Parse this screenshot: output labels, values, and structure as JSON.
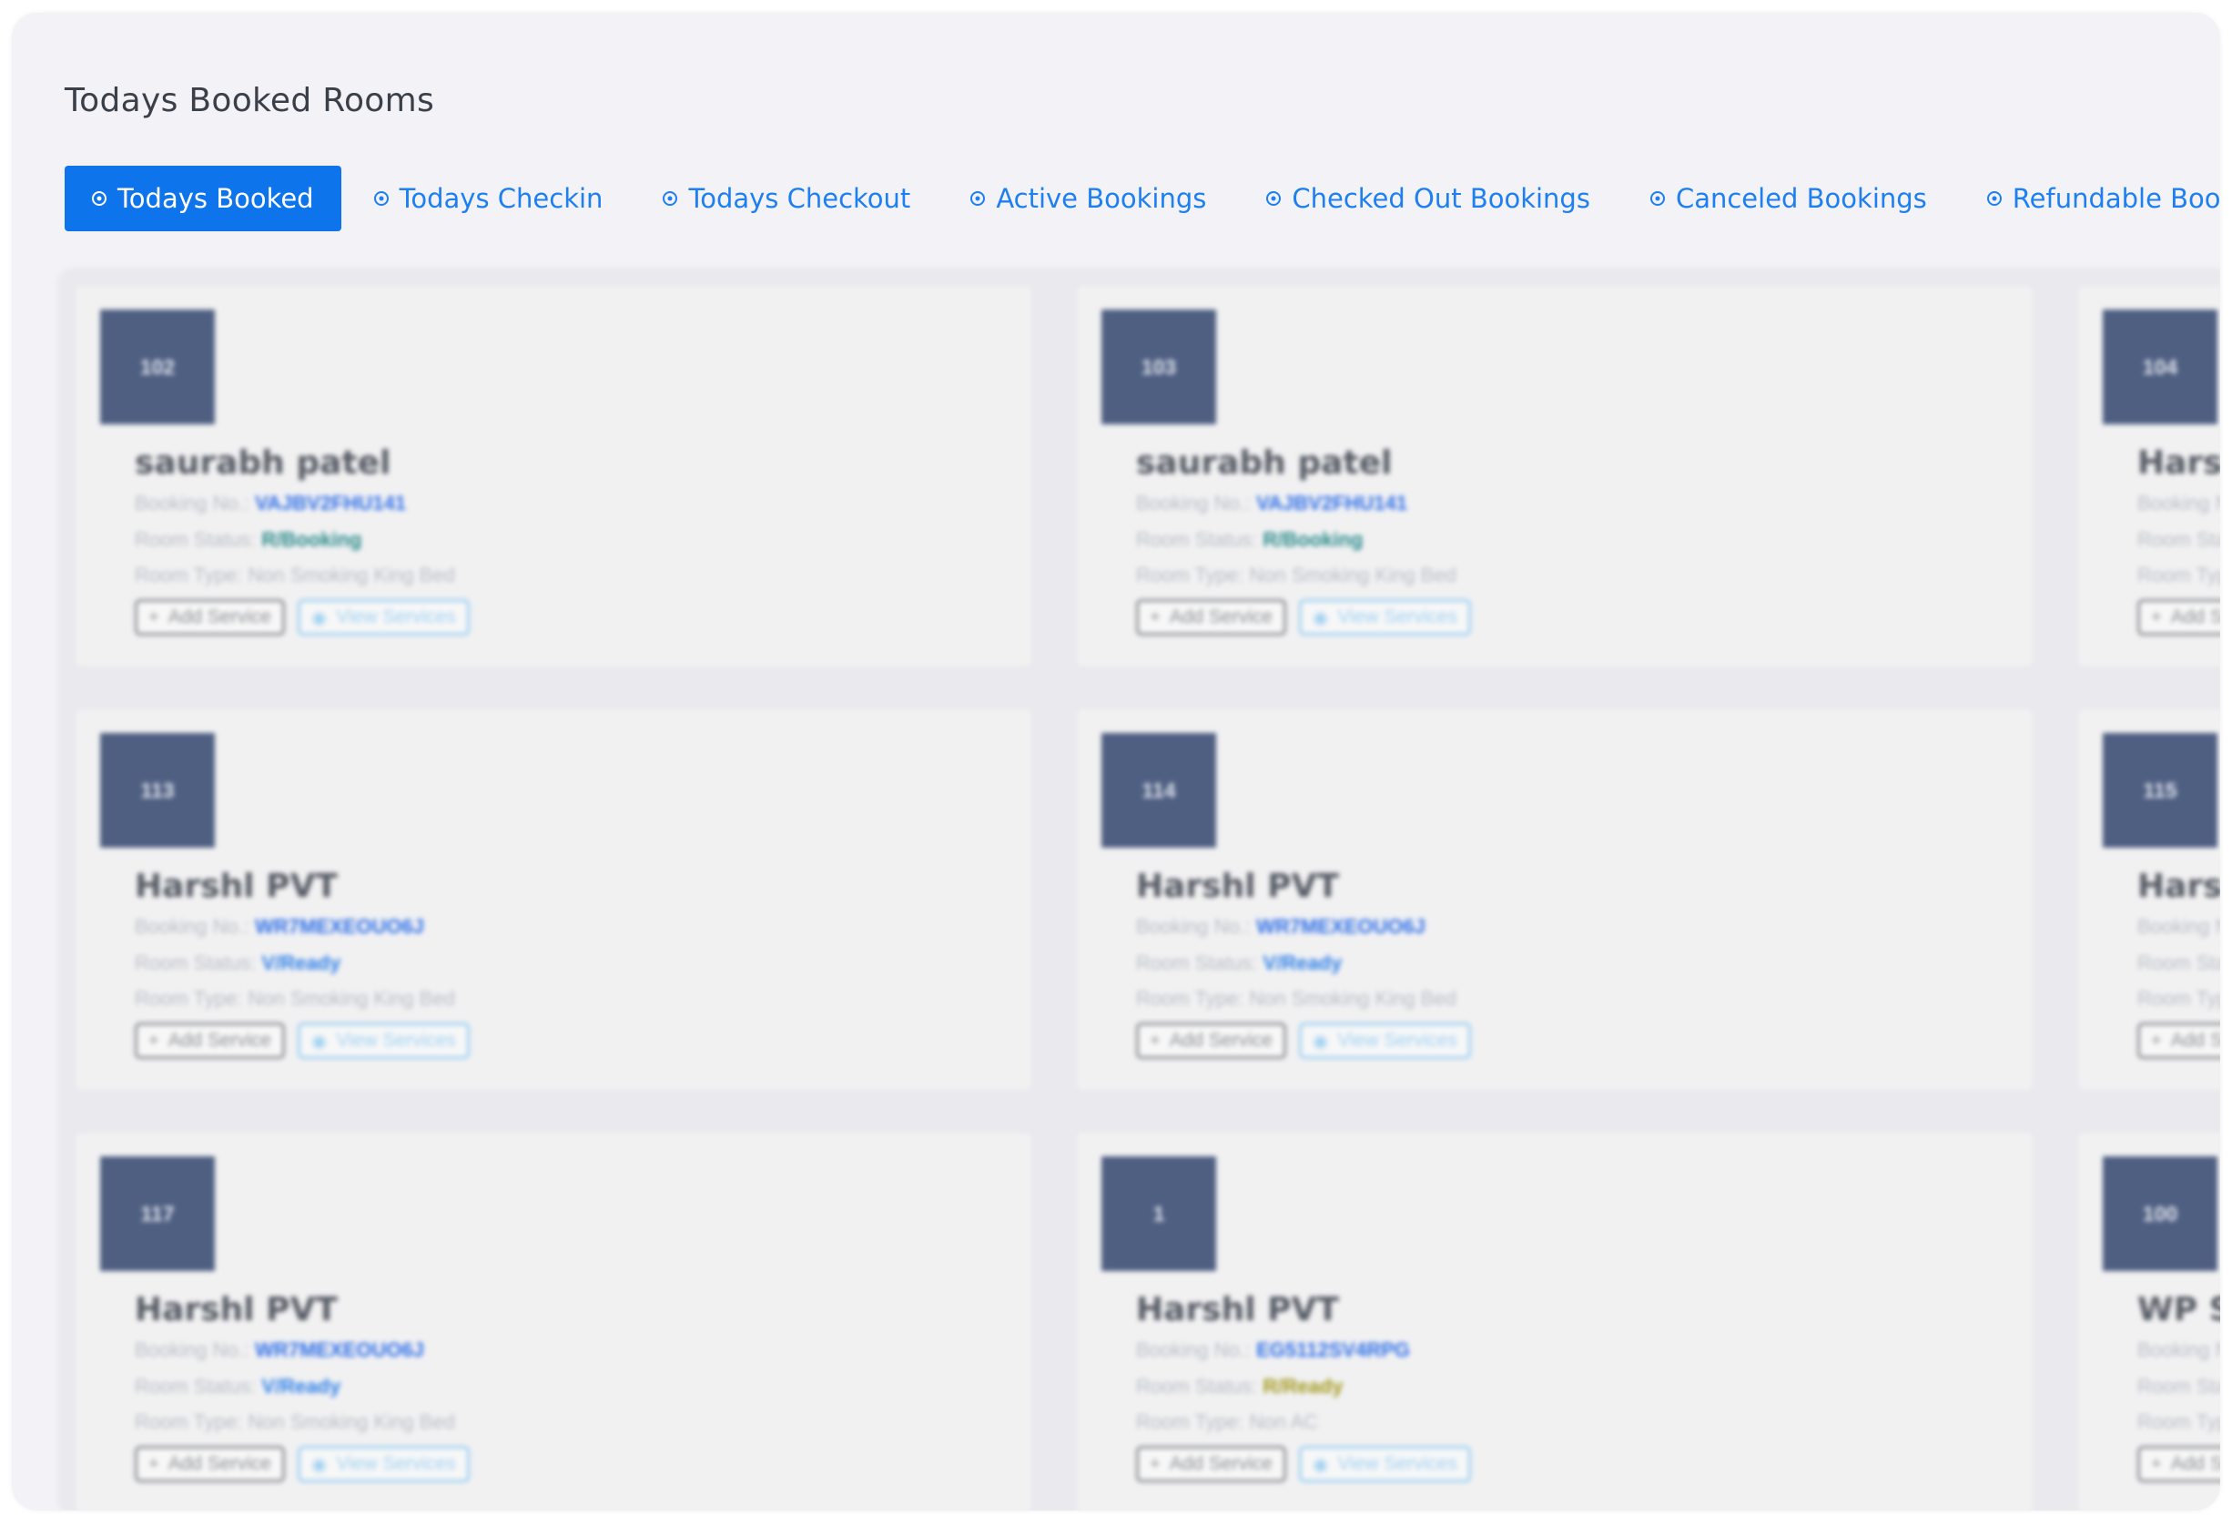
{
  "page": {
    "title": "Todays Booked Rooms"
  },
  "tabs": [
    {
      "label": "Todays Booked",
      "active": true
    },
    {
      "label": "Todays Checkin",
      "active": false
    },
    {
      "label": "Todays Checkout",
      "active": false
    },
    {
      "label": "Active Bookings",
      "active": false
    },
    {
      "label": "Checked Out Bookings",
      "active": false
    },
    {
      "label": "Canceled Bookings",
      "active": false
    },
    {
      "label": "Refundable Bookings",
      "active": false
    }
  ],
  "labels": {
    "booking_no": "Booking No.:",
    "room_status": "Room Status:",
    "room_type": "Room Type:",
    "add_service": "Add Service",
    "view_services": "View Services"
  },
  "cards": [
    {
      "room": "102",
      "guest": "saurabh patel",
      "booking_no": "VAJBV2FHU141",
      "status": "R/Booking",
      "status_color": "#2a8a8a",
      "room_type": "Non Smoking King Bed"
    },
    {
      "room": "103",
      "guest": "saurabh patel",
      "booking_no": "VAJBV2FHU141",
      "status": "R/Booking",
      "status_color": "#2a8a8a",
      "room_type": "Non Smoking King Bed"
    },
    {
      "room": "104",
      "guest": "Harsh",
      "booking_no": "",
      "status": "",
      "status_color": "#2a8a8a",
      "room_type": ""
    },
    {
      "room": "113",
      "guest": "Harshl PVT",
      "booking_no": "WR7MEXEOUO6J",
      "status": "V/Ready",
      "status_color": "#2f80e8",
      "room_type": "Non Smoking King Bed"
    },
    {
      "room": "114",
      "guest": "Harshl PVT",
      "booking_no": "WR7MEXEOUO6J",
      "status": "V/Ready",
      "status_color": "#2f80e8",
      "room_type": "Non Smoking King Bed"
    },
    {
      "room": "115",
      "guest": "Harsh",
      "booking_no": "",
      "status": "",
      "status_color": "#2f80e8",
      "room_type": ""
    },
    {
      "room": "117",
      "guest": "Harshl PVT",
      "booking_no": "WR7MEXEOUO6J",
      "status": "V/Ready",
      "status_color": "#2f80e8",
      "room_type": "Non Smoking King Bed"
    },
    {
      "room": "1",
      "guest": "Harshl PVT",
      "booking_no": "EG5112SV4RPG",
      "status": "R/Ready",
      "status_color": "#a39a1e",
      "room_type": "Non AC"
    },
    {
      "room": "100",
      "guest": "WP SE",
      "booking_no": "",
      "status": "",
      "status_color": "#2f80e8",
      "room_type": ""
    }
  ],
  "colors": {
    "accent": "#0d74eb",
    "booking_link": "#2f6fe8",
    "badge_bg": "#4f5f82"
  }
}
